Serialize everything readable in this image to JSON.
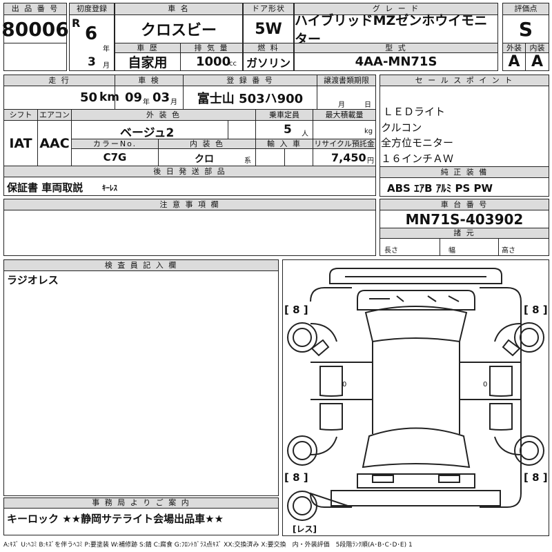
{
  "header": {
    "lot_label": "出 品 番 号",
    "lot_number": "80006",
    "first_reg_label": "初度登録",
    "era": "R",
    "year": "6",
    "year_unit": "年",
    "month": "3",
    "month_unit": "月",
    "car_name_label": "車 名",
    "car_name": "クロスビー",
    "history_label": "車 歴",
    "history": "自家用",
    "displacement_label": "排 気 量",
    "displacement": "1000",
    "displacement_unit": "cc",
    "door_label": "ドア形状",
    "door": "5W",
    "fuel_label": "燃 料",
    "fuel": "ガソリン",
    "grade_label": "グ レ ー ド",
    "grade": "ハイブリッドMZゼンホウイモニター",
    "model_label": "型 式",
    "model": "4AA-MN71S",
    "score_label": "評価点",
    "score": "S",
    "exterior_label": "外装",
    "exterior": "A",
    "interior_label": "内装",
    "interior": "A"
  },
  "row2": {
    "mileage_label": "走 行",
    "mileage": "50",
    "mileage_unit": "km",
    "inspection_label": "車 検",
    "insp_year": "09",
    "insp_year_unit": "年",
    "insp_month": "03",
    "insp_month_unit": "月",
    "plate_label": "登 録 番 号",
    "plate": "富士山 503ハ900",
    "transfer_label": "譲渡書類期限",
    "transfer_month_unit": "月",
    "transfer_day_unit": "日",
    "shift_label": "シフト",
    "shift": "IAT",
    "ac_label": "エアコン",
    "ac": "AAC",
    "color_label": "外 装 色",
    "color": "ベージュ2",
    "capacity_label": "乗車定員",
    "capacity": "5",
    "capacity_unit": "人",
    "load_label": "最大積載量",
    "load_unit": "kg",
    "color_no_label": "カラーNo.",
    "color_no": "C7G",
    "int_color_label": "内 装 色",
    "int_color": "クロ",
    "int_color_suffix": "系",
    "import_label": "輸 入 車",
    "recycle_label": "リサイクル預託金",
    "recycle": "7,450",
    "recycle_unit": "円"
  },
  "later_parts": {
    "label": "後 日 発 送 部 品",
    "text_a": "保証書 車両取説",
    "text_b": "ｷｰﾚｽ"
  },
  "sales": {
    "label": "セ ー ル ス ポ イ ン ト",
    "items": [
      "ＬＥＤライト",
      "クルコン",
      "全方位モニター",
      "１６インチＡＷ"
    ]
  },
  "equip": {
    "label": "純 正 装 備",
    "text": "ABS ｴｱB ｱﾙﾐ PS PW"
  },
  "notes": {
    "label": "注 意 事 項 欄"
  },
  "chassis": {
    "label": "車 台 番 号",
    "number": "MN71S-403902",
    "spec_label": "諸 元",
    "length": "長さ",
    "width": "幅",
    "height": "高さ"
  },
  "inspector": {
    "label": "検 査 員 記 入 欄",
    "text": "ラジオレス"
  },
  "diagram": {
    "tl": "[ 8 ]",
    "tr": "[ 8 ]",
    "bl": "[ 8 ]",
    "br": "[ 8 ]",
    "spare": "[レス]",
    "mark_left": "0",
    "mark_right": "0"
  },
  "office": {
    "label": "事 務 局 よ り ご 案 内",
    "text": "キーロック ★★静岡サテライト会場出品車★★"
  },
  "legend": {
    "text": "A:ｷｽﾞ U:ﾍｺﾐ B:ｷｽﾞを伴うﾍｺﾐ P:要塗装 W:補修跡 S:錆 C:腐食 G:ﾌﾛﾝﾄｶﾞﾗｽ点ｷｽﾞ XX:交換済み X:要交換　内・外装評価　5段階ﾗﾝｸ順(A･B･C･D･E) 1"
  }
}
